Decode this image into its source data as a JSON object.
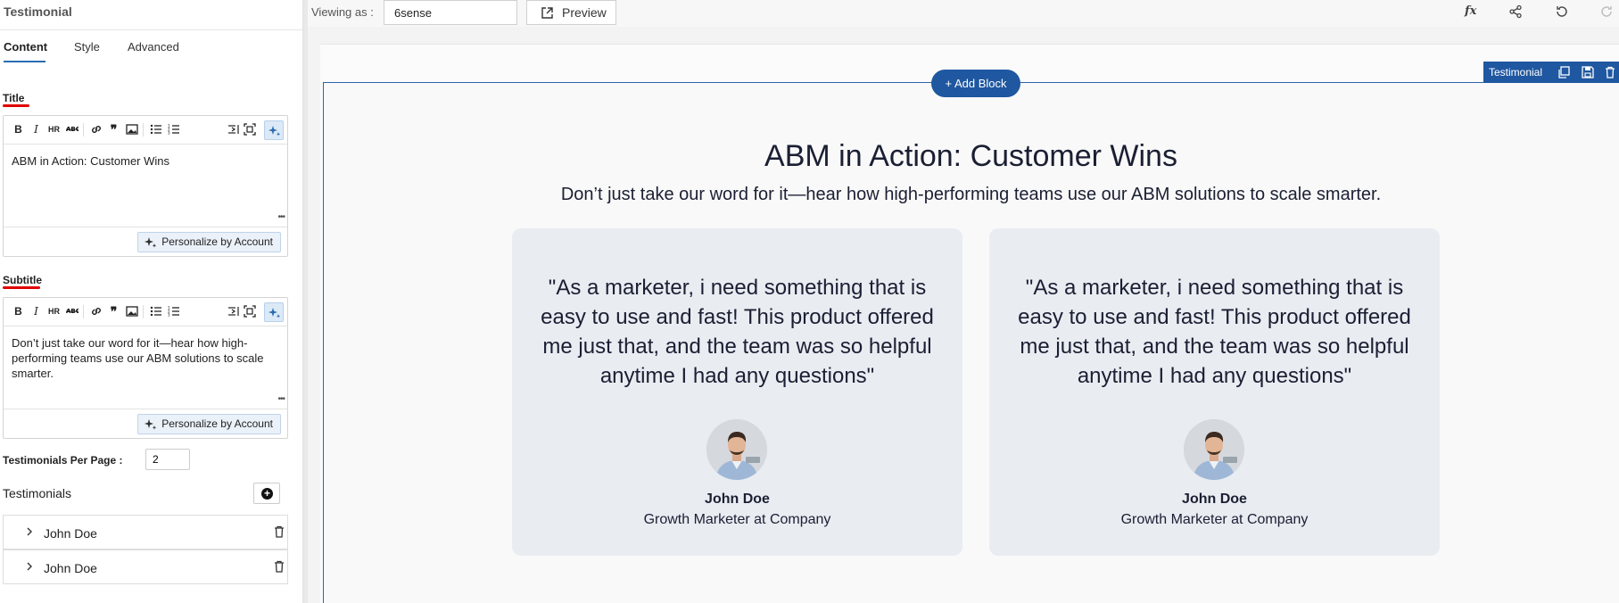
{
  "panel": {
    "title": "Testimonial",
    "tabs": [
      {
        "label": "Content",
        "active": true
      },
      {
        "label": "Style",
        "active": false
      },
      {
        "label": "Advanced",
        "active": false
      }
    ],
    "title_field": {
      "label": "Title",
      "value": "ABM in Action: Customer Wins",
      "personalize_label": "Personalize by Account"
    },
    "subtitle_field": {
      "label": "Subtitle",
      "value": "Don’t just take our word for it—hear how high-performing teams use our ABM solutions to scale smarter.",
      "personalize_label": "Personalize by Account"
    },
    "per_page": {
      "label": "Testimonials Per Page :",
      "value": "2"
    },
    "testimonials_label": "Testimonials",
    "testimonials": [
      {
        "name": "John Doe"
      },
      {
        "name": "John Doe"
      }
    ]
  },
  "topbar": {
    "viewing_label": "Viewing as :",
    "viewing_value": "6sense",
    "preview_label": "Preview",
    "fx_label": "fx"
  },
  "canvas": {
    "add_block_label": "+ Add Block",
    "block_tag_label": "Testimonial",
    "section_title": "ABM in Action: Customer Wins",
    "section_subtitle": "Don’t just take our word for it—hear how high-performing teams use our ABM solutions to scale smarter.",
    "cards": [
      {
        "quote": "\"As a marketer, i need something that is easy to use and fast! This product offered me just that, and the team was so helpful anytime I had any questions\"",
        "name": "John Doe",
        "role": "Growth Marketer at Company"
      },
      {
        "quote": "\"As a marketer, i need something that is easy to use and fast! This product offered me just that, and the team was so helpful anytime I had any questions\"",
        "name": "John Doe",
        "role": "Growth Marketer at Company"
      }
    ]
  },
  "colors": {
    "accent": "#1f57a0",
    "card_bg": "#e9ecf1",
    "highlight_red": "#e00000"
  }
}
